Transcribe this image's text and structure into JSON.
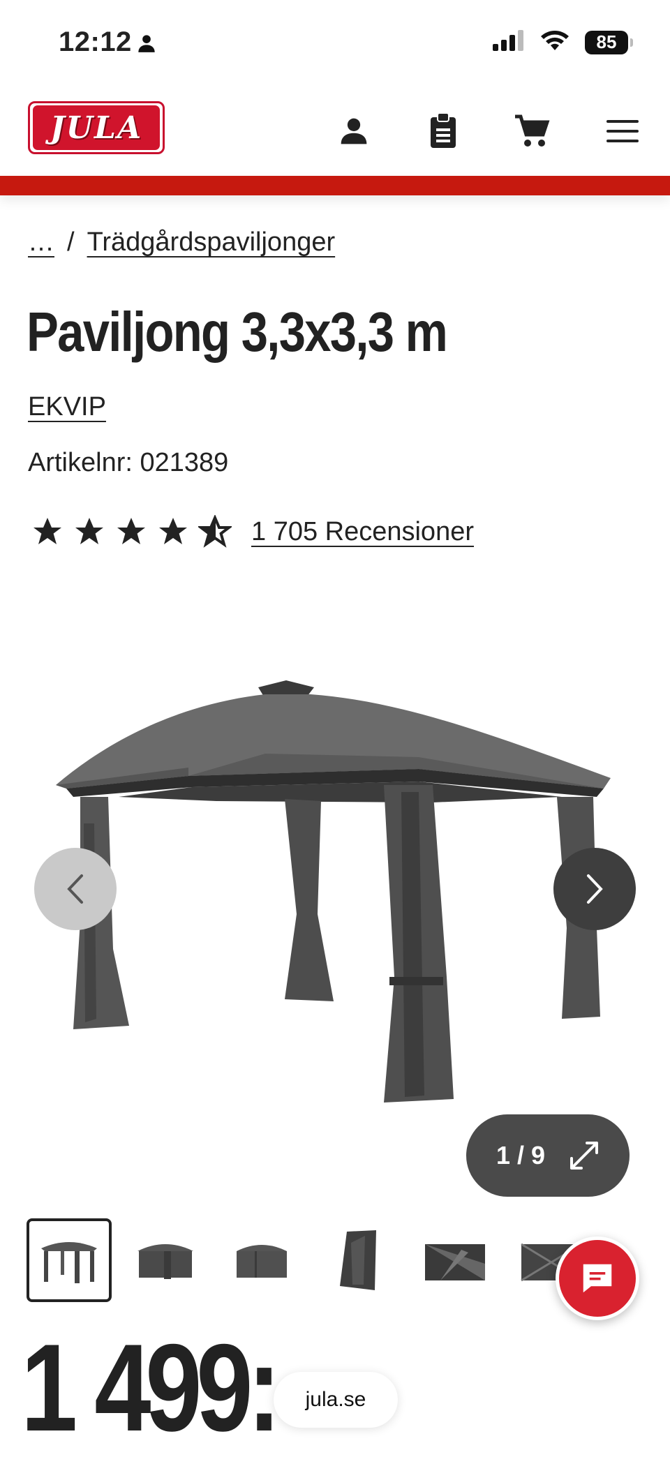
{
  "status": {
    "time": "12:12",
    "battery": "85"
  },
  "header": {
    "logo_text": "JULA",
    "accent_color": "#c6190f"
  },
  "breadcrumb": {
    "ellipsis": "…",
    "separator": "/",
    "current": "Trädgårdspaviljonger"
  },
  "product": {
    "title": "Paviljong 3,3x3,3 m",
    "brand": "EKVIP",
    "article": "Artikelnr: 021389",
    "rating": 4.5,
    "reviews": "1 705 Recensioner",
    "price": "1 499:-"
  },
  "gallery": {
    "counter": "1 / 9",
    "thumbnail_count": 6
  },
  "browser": {
    "url": "jula.se"
  }
}
